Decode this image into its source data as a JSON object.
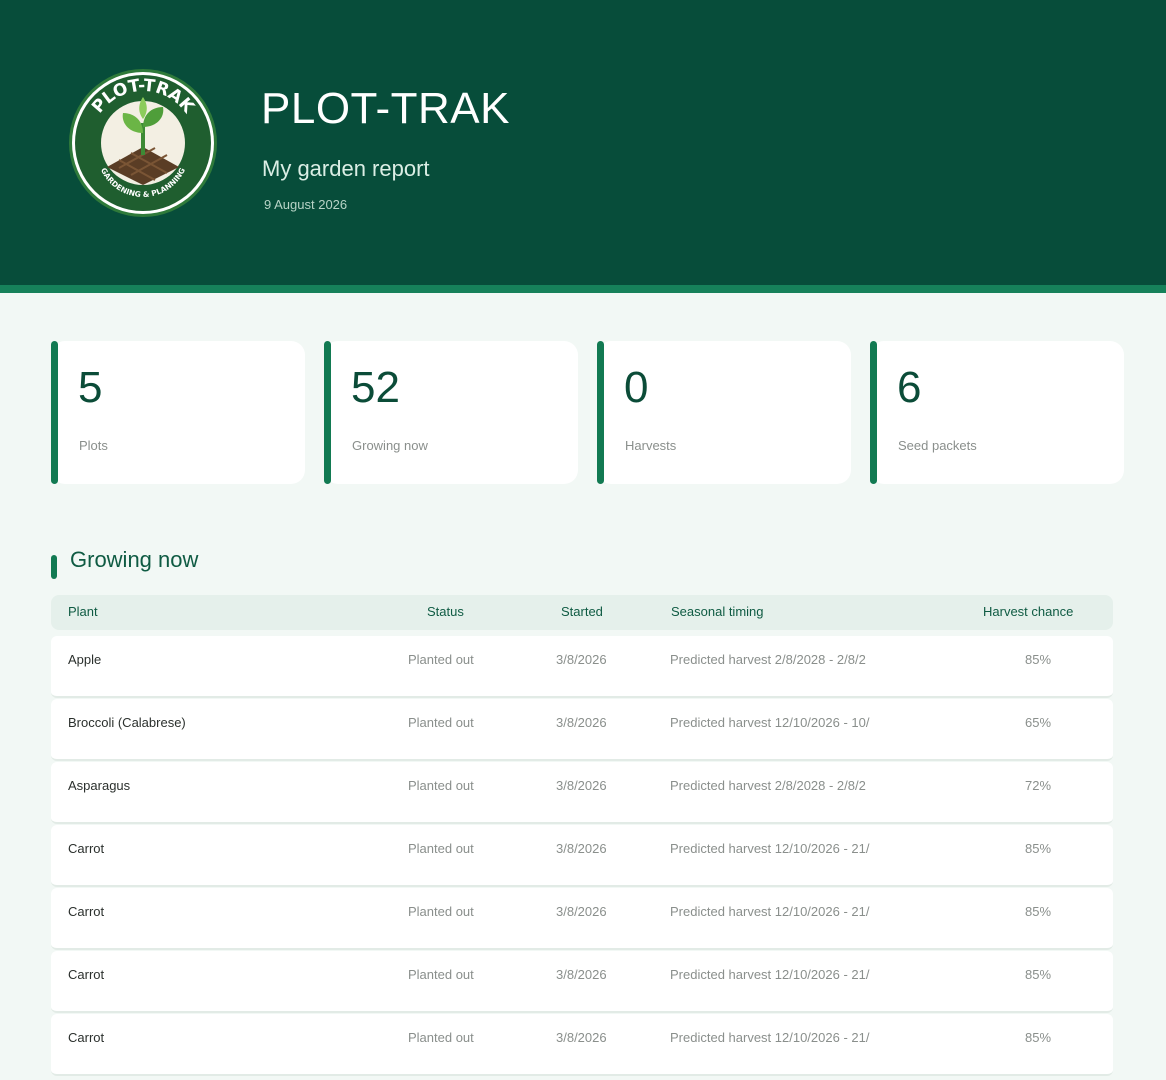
{
  "header": {
    "title": "PLOT-TRAK",
    "subtitle": "My garden report",
    "date": "9 August 2026",
    "logo": {
      "text_top": "PLOT-TRAK",
      "text_bottom": "GARDENING & PLANNING"
    }
  },
  "colors": {
    "header_bg": "#074d3a",
    "accent": "#16815a",
    "page_bg": "#f2f8f5"
  },
  "stats": [
    {
      "value": "5",
      "label": "Plots"
    },
    {
      "value": "52",
      "label": "Growing now"
    },
    {
      "value": "0",
      "label": "Harvests"
    },
    {
      "value": "6",
      "label": "Seed packets"
    }
  ],
  "section": {
    "title": "Growing now"
  },
  "table": {
    "columns": [
      "Plant",
      "Status",
      "Started",
      "Seasonal timing",
      "Harvest chance"
    ],
    "rows": [
      {
        "plant": "Apple",
        "status": "Planted out",
        "started": "3/8/2026",
        "timing": "Predicted harvest 2/8/2028 - 2/8/2",
        "chance": "85%"
      },
      {
        "plant": "Broccoli (Calabrese)",
        "status": "Planted out",
        "started": "3/8/2026",
        "timing": "Predicted harvest 12/10/2026 - 10/",
        "chance": "65%"
      },
      {
        "plant": "Asparagus",
        "status": "Planted out",
        "started": "3/8/2026",
        "timing": "Predicted harvest 2/8/2028 - 2/8/2",
        "chance": "72%"
      },
      {
        "plant": "Carrot",
        "status": "Planted out",
        "started": "3/8/2026",
        "timing": "Predicted harvest 12/10/2026 - 21/",
        "chance": "85%"
      },
      {
        "plant": "Carrot",
        "status": "Planted out",
        "started": "3/8/2026",
        "timing": "Predicted harvest 12/10/2026 - 21/",
        "chance": "85%"
      },
      {
        "plant": "Carrot",
        "status": "Planted out",
        "started": "3/8/2026",
        "timing": "Predicted harvest 12/10/2026 - 21/",
        "chance": "85%"
      },
      {
        "plant": "Carrot",
        "status": "Planted out",
        "started": "3/8/2026",
        "timing": "Predicted harvest 12/10/2026 - 21/",
        "chance": "85%"
      }
    ]
  }
}
